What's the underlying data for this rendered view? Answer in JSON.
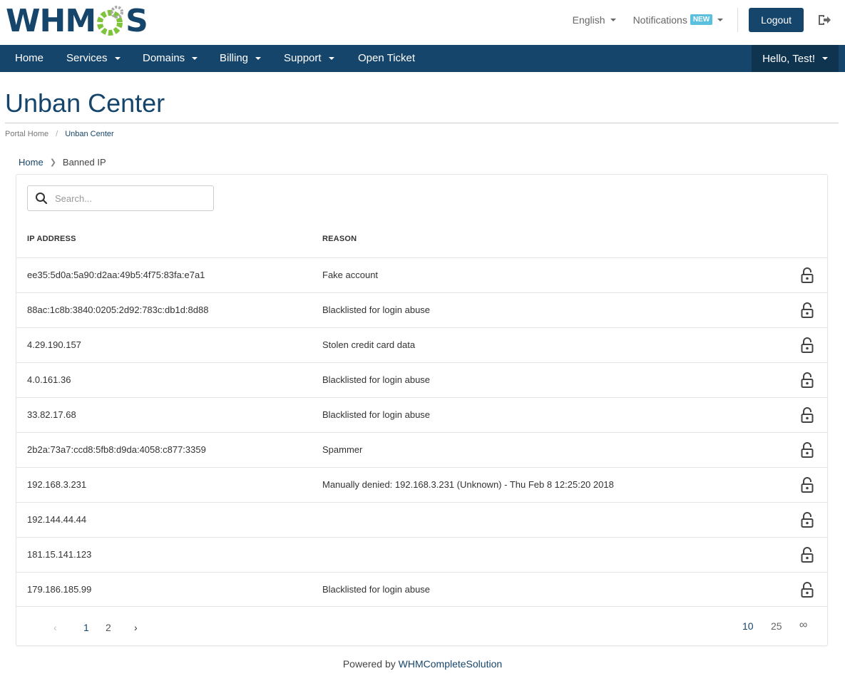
{
  "logo": {
    "text_left": "WHM",
    "text_right": "S"
  },
  "top": {
    "language": "English",
    "notifications": "Notifications",
    "notifications_badge": "NEW",
    "logout": "Logout"
  },
  "nav": {
    "items": [
      {
        "label": "Home",
        "dropdown": false
      },
      {
        "label": "Services",
        "dropdown": true
      },
      {
        "label": "Domains",
        "dropdown": true
      },
      {
        "label": "Billing",
        "dropdown": true
      },
      {
        "label": "Support",
        "dropdown": true
      },
      {
        "label": "Open Ticket",
        "dropdown": false
      }
    ],
    "user": "Hello, Test!"
  },
  "page": {
    "title": "Unban Center",
    "breadcrumb": [
      "Portal Home",
      "Unban Center"
    ],
    "subcrumb": {
      "home": "Home",
      "current": "Banned IP"
    }
  },
  "search": {
    "placeholder": "Search..."
  },
  "table": {
    "headers": {
      "ip": "IP ADDRESS",
      "reason": "REASON"
    },
    "rows": [
      {
        "ip": "ee35:5d0a:5a90:d2aa:49b5:4f75:83fa:e7a1",
        "reason": "Fake account"
      },
      {
        "ip": "88ac:1c8b:3840:0205:2d92:783c:db1d:8d88",
        "reason": "Blacklisted for login abuse"
      },
      {
        "ip": "4.29.190.157",
        "reason": "Stolen credit card data"
      },
      {
        "ip": "4.0.161.36",
        "reason": "Blacklisted for login abuse"
      },
      {
        "ip": "33.82.17.68",
        "reason": "Blacklisted for login abuse"
      },
      {
        "ip": "2b2a:73a7:ccd8:5fb8:d9da:4058:c877:3359",
        "reason": "Spammer"
      },
      {
        "ip": "192.168.3.231",
        "reason": "Manually denied: 192.168.3.231 (Unknown) - Thu Feb 8 12:25:20 2018"
      },
      {
        "ip": "192.144.44.44",
        "reason": ""
      },
      {
        "ip": "181.15.141.123",
        "reason": ""
      },
      {
        "ip": "179.186.185.99",
        "reason": "Blacklisted for login abuse"
      }
    ],
    "row_action_icon": "unlock-icon"
  },
  "pagination": {
    "prev": "‹",
    "pages": [
      "1",
      "2"
    ],
    "next": "›",
    "per_page": [
      "10",
      "25",
      "∞"
    ]
  },
  "footer": {
    "prefix": "Powered by ",
    "link": "WHMCompleteSolution"
  },
  "colors": {
    "brand": "#16456b",
    "accent_green": "#7ec43b",
    "badge": "#5bc0de"
  }
}
